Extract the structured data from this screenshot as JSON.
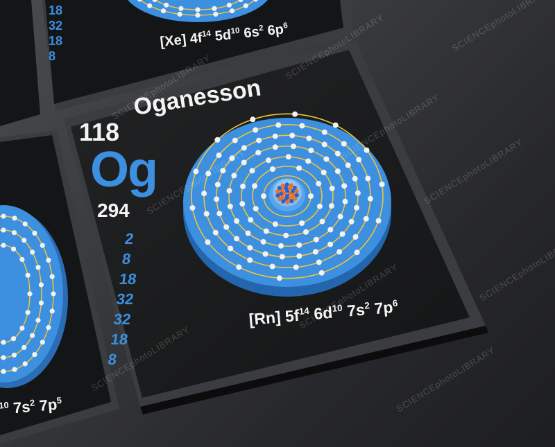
{
  "main_tile": {
    "atomic_number": "118",
    "name": "Oganesson",
    "symbol": "Og",
    "mass": "294",
    "shells": [
      "2",
      "8",
      "18",
      "32",
      "32",
      "18",
      "8"
    ],
    "config_prefix": "[Rn]",
    "config_parts": [
      {
        "base": "5f",
        "sup": "14"
      },
      {
        "base": "6d",
        "sup": "10"
      },
      {
        "base": "7s",
        "sup": "2"
      },
      {
        "base": "7p",
        "sup": "6"
      }
    ]
  },
  "top_tile": {
    "shells": [
      "18",
      "32",
      "18",
      "8"
    ],
    "config_prefix": "[Xe]",
    "config_parts": [
      {
        "base": "4f",
        "sup": "14"
      },
      {
        "base": "5d",
        "sup": "10"
      },
      {
        "base": "6s",
        "sup": "2"
      },
      {
        "base": "6p",
        "sup": "6"
      }
    ]
  },
  "left_tile": {
    "config_lead_sup": "10",
    "config_parts": [
      {
        "base": "7s",
        "sup": "2"
      },
      {
        "base": "7p",
        "sup": "5"
      }
    ]
  },
  "watermark": "SCIENCEphotoLIBRARY",
  "colors": {
    "tile_face": "#141516",
    "shell_blue": "#3d8fe0",
    "orbit_yellow": "#f0c53a",
    "electron": "#f2f2f2"
  }
}
